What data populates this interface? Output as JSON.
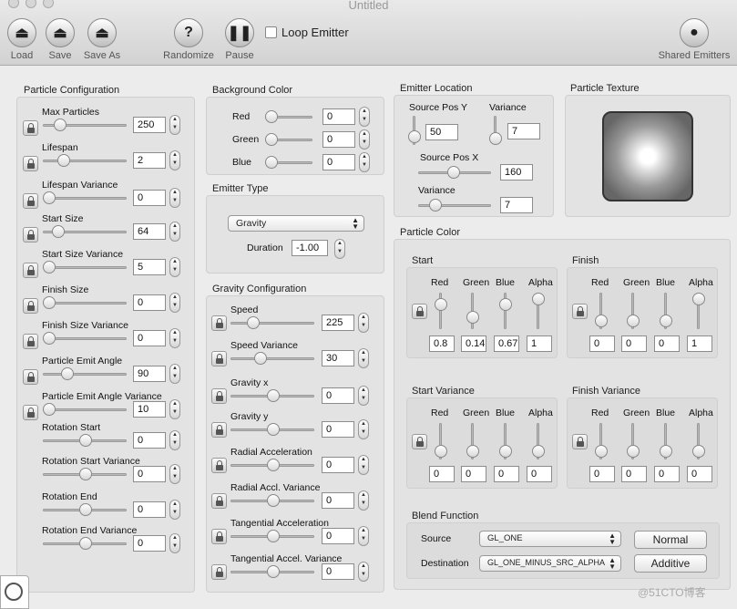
{
  "window": {
    "title": "Untitled"
  },
  "toolbar": {
    "load": "Load",
    "save": "Save",
    "save_as": "Save As",
    "randomize": "Randomize",
    "pause": "Pause",
    "loop_emitter": "Loop Emitter",
    "shared_emitters": "Shared Emitters"
  },
  "particle_config": {
    "title": "Particle Configuration",
    "rows": [
      {
        "label": "Max Particles",
        "value": "250"
      },
      {
        "label": "Lifespan",
        "value": "2"
      },
      {
        "label": "Lifespan Variance",
        "value": "0"
      },
      {
        "label": "Start Size",
        "value": "64"
      },
      {
        "label": "Start Size Variance",
        "value": "5"
      },
      {
        "label": "Finish Size",
        "value": "0"
      },
      {
        "label": "Finish Size Variance",
        "value": "0"
      },
      {
        "label": "Particle Emit Angle",
        "value": "90"
      },
      {
        "label": "Particle Emit Angle Variance",
        "value": "10"
      },
      {
        "label": "Rotation Start",
        "value": "0"
      },
      {
        "label": "Rotation Start Variance",
        "value": "0"
      },
      {
        "label": "Rotation End",
        "value": "0"
      },
      {
        "label": "Rotation End Variance",
        "value": "0"
      }
    ]
  },
  "background_color": {
    "title": "Background Color",
    "rows": [
      {
        "label": "Red",
        "value": "0"
      },
      {
        "label": "Green",
        "value": "0"
      },
      {
        "label": "Blue",
        "value": "0"
      }
    ]
  },
  "emitter_type": {
    "title": "Emitter Type",
    "selected": "Gravity",
    "duration_label": "Duration",
    "duration": "-1.00"
  },
  "gravity_config": {
    "title": "Gravity Configuration",
    "rows": [
      {
        "label": "Speed",
        "value": "225"
      },
      {
        "label": "Speed Variance",
        "value": "30"
      },
      {
        "label": "Gravity x",
        "value": "0"
      },
      {
        "label": "Gravity y",
        "value": "0"
      },
      {
        "label": "Radial Acceleration",
        "value": "0"
      },
      {
        "label": "Radial Accl. Variance",
        "value": "0"
      },
      {
        "label": "Tangential Acceleration",
        "value": "0"
      },
      {
        "label": "Tangential Accel. Variance",
        "value": "0"
      }
    ]
  },
  "emitter_location": {
    "title": "Emitter Location",
    "source_pos_y_label": "Source Pos Y",
    "source_pos_y": "50",
    "variance_label": "Variance",
    "variance_y": "7",
    "source_pos_x_label": "Source Pos X",
    "source_pos_x": "160",
    "variance_x": "7"
  },
  "particle_texture": {
    "title": "Particle Texture"
  },
  "particle_color": {
    "title": "Particle Color",
    "channel_labels": [
      "Red",
      "Green",
      "Blue",
      "Alpha"
    ],
    "start": {
      "title": "Start",
      "values": [
        "0.8",
        "0.14",
        "0.67",
        "1"
      ]
    },
    "finish": {
      "title": "Finish",
      "values": [
        "0",
        "0",
        "0",
        "1"
      ]
    },
    "start_variance": {
      "title": "Start Variance",
      "values": [
        "0",
        "0",
        "0",
        "0"
      ]
    },
    "finish_variance": {
      "title": "Finish Variance",
      "values": [
        "0",
        "0",
        "0",
        "0"
      ]
    }
  },
  "blend_function": {
    "title": "Blend Function",
    "source_label": "Source",
    "source": "GL_ONE",
    "destination_label": "Destination",
    "destination": "GL_ONE_MINUS_SRC_ALPHA",
    "normal": "Normal",
    "additive": "Additive"
  },
  "watermark": "@51CTO博客"
}
